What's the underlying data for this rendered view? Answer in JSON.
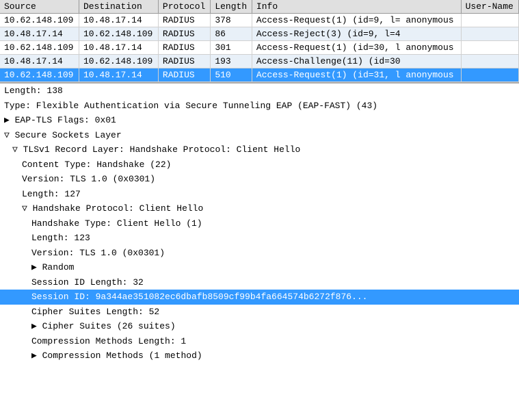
{
  "table": {
    "headers": [
      "Source",
      "Destination",
      "Protocol",
      "Length",
      "Info",
      "User-Name"
    ],
    "rows": [
      {
        "source": "10.62.148.109",
        "destination": "10.48.17.14",
        "protocol": "RADIUS",
        "length": "378",
        "info": "Access-Request(1) (id=9, l= anonymous",
        "username": "",
        "selected": false
      },
      {
        "source": "10.48.17.14",
        "destination": "10.62.148.109",
        "protocol": "RADIUS",
        "length": "86",
        "info": "Access-Reject(3) (id=9, l=4",
        "username": "",
        "selected": false
      },
      {
        "source": "10.62.148.109",
        "destination": "10.48.17.14",
        "protocol": "RADIUS",
        "length": "301",
        "info": "Access-Request(1) (id=30, l anonymous",
        "username": "",
        "selected": false
      },
      {
        "source": "10.48.17.14",
        "destination": "10.62.148.109",
        "protocol": "RADIUS",
        "length": "193",
        "info": "Access-Challenge(11) (id=30",
        "username": "",
        "selected": false
      },
      {
        "source": "10.62.148.109",
        "destination": "10.48.17.14",
        "protocol": "RADIUS",
        "length": "510",
        "info": "Access-Request(1) (id=31, l anonymous",
        "username": "",
        "selected": true
      }
    ]
  },
  "detail": {
    "lines": [
      {
        "indent": 0,
        "text": "Length: 138",
        "type": "plain",
        "selected": false
      },
      {
        "indent": 0,
        "text": "Type: Flexible Authentication via Secure Tunneling EAP (EAP-FAST) (43)",
        "type": "plain",
        "selected": false
      },
      {
        "indent": 0,
        "text": "▶ EAP-TLS Flags: 0x01",
        "type": "collapsible",
        "selected": false
      },
      {
        "indent": 0,
        "text": "▽ Secure Sockets Layer",
        "type": "section",
        "selected": false
      },
      {
        "indent": 1,
        "text": "▽ TLSv1 Record Layer: Handshake Protocol: Client Hello",
        "type": "section",
        "selected": false
      },
      {
        "indent": 2,
        "text": "Content Type: Handshake (22)",
        "type": "plain",
        "selected": false
      },
      {
        "indent": 2,
        "text": "Version: TLS 1.0 (0x0301)",
        "type": "plain",
        "selected": false
      },
      {
        "indent": 2,
        "text": "Length: 127",
        "type": "plain",
        "selected": false
      },
      {
        "indent": 2,
        "text": "▽ Handshake Protocol: Client Hello",
        "type": "section",
        "selected": false
      },
      {
        "indent": 3,
        "text": "Handshake Type: Client Hello (1)",
        "type": "plain",
        "selected": false
      },
      {
        "indent": 3,
        "text": "Length: 123",
        "type": "plain",
        "selected": false
      },
      {
        "indent": 3,
        "text": "Version: TLS 1.0 (0x0301)",
        "type": "plain",
        "selected": false
      },
      {
        "indent": 3,
        "text": "▶ Random",
        "type": "collapsible",
        "selected": false
      },
      {
        "indent": 3,
        "text": "Session ID Length: 32",
        "type": "plain",
        "selected": false
      },
      {
        "indent": 3,
        "text": "Session ID: 9a344ae351082ec6dbafb8509cf99b4fa664574b6272f876...",
        "type": "plain",
        "selected": true
      },
      {
        "indent": 3,
        "text": "Cipher Suites Length: 52",
        "type": "plain",
        "selected": false
      },
      {
        "indent": 3,
        "text": "▶ Cipher Suites (26 suites)",
        "type": "collapsible",
        "selected": false
      },
      {
        "indent": 3,
        "text": "Compression Methods Length: 1",
        "type": "plain",
        "selected": false
      },
      {
        "indent": 3,
        "text": "▶ Compression Methods (1 method)",
        "type": "collapsible",
        "selected": false
      }
    ]
  }
}
